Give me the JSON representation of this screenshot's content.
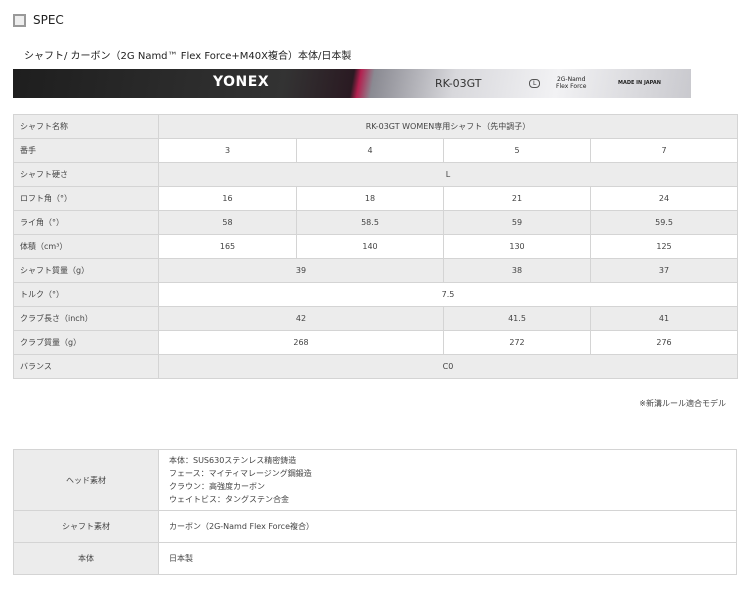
{
  "header": {
    "title": "SPEC"
  },
  "caption": "シャフト/ カーボン（2G Namd™ Flex Force+M40X複合）本体/日本製",
  "shaft_image": {
    "brand": "YONEX",
    "model": "RK-03GT",
    "flex": "L",
    "tech_top": "2G-Namd",
    "tech_bottom": "Flex Force",
    "made": "MADE IN JAPAN"
  },
  "spec_table": {
    "shaft_name": {
      "label": "シャフト名称",
      "value": "RK-03GT WOMEN専用シャフト（先中調子）"
    },
    "number": {
      "label": "番手",
      "values": [
        "3",
        "4",
        "5",
        "7"
      ]
    },
    "flex": {
      "label": "シャフト硬さ",
      "value": "L"
    },
    "loft": {
      "label": "ロフト角（°）",
      "values": [
        "16",
        "18",
        "21",
        "24"
      ]
    },
    "lie": {
      "label": "ライ角（°）",
      "values": [
        "58",
        "58.5",
        "59",
        "59.5"
      ]
    },
    "volume": {
      "label": "体積（cm³）",
      "values": [
        "165",
        "140",
        "130",
        "125"
      ]
    },
    "shaft_weight": {
      "label": "シャフト質量（g）",
      "values": [
        "39",
        "38",
        "37"
      ]
    },
    "torque": {
      "label": "トルク（°）",
      "value": "7.5"
    },
    "length": {
      "label": "クラブ長さ（inch）",
      "values": [
        "42",
        "41.5",
        "41"
      ]
    },
    "club_weight": {
      "label": "クラブ質量（g）",
      "values": [
        "268",
        "272",
        "276"
      ]
    },
    "balance": {
      "label": "バランス",
      "value": "C0"
    }
  },
  "note": "※新溝ルール適合モデル",
  "material_table": {
    "head": {
      "label": "ヘッド素材",
      "lines": [
        "本体：SUS630ステンレス精密鋳造",
        "フェース：マイティマレージング鋼鍛造",
        "クラウン：高強度カーボン",
        "ウェイトビス：タングステン合金"
      ]
    },
    "shaft": {
      "label": "シャフト素材",
      "value": "カーボン（2G-Namd Flex Force複合）"
    },
    "body": {
      "label": "本体",
      "value": "日本製"
    }
  }
}
